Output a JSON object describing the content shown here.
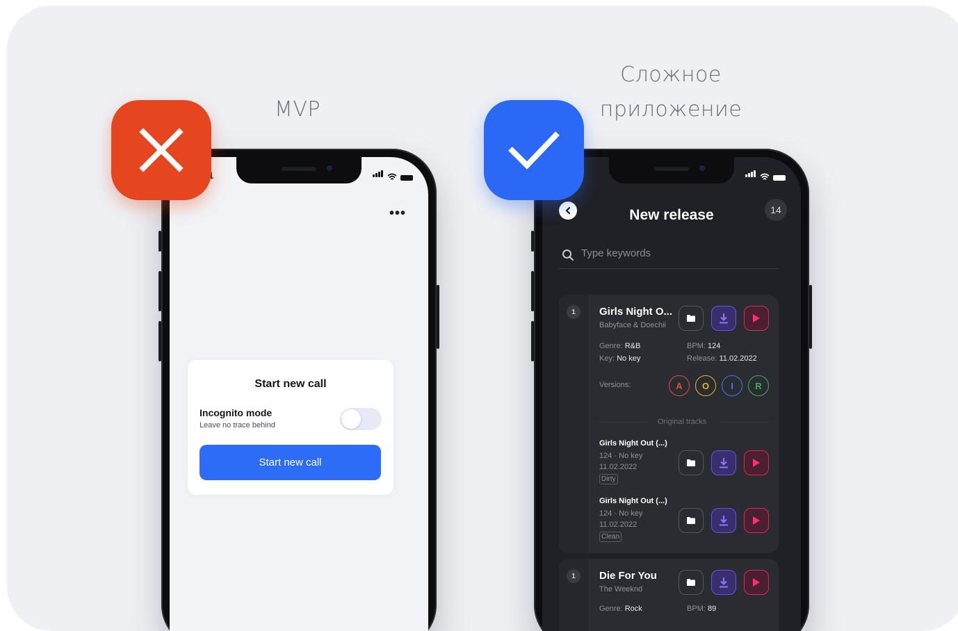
{
  "labels": {
    "mvp": "MVP",
    "complex_line1": "Сложное",
    "complex_line2": "приложение"
  },
  "colors": {
    "bad": "#e5461f",
    "good": "#2a68f5",
    "accent_blue": "#2d6cf6",
    "play_red": "#e0245e",
    "download_purple": "#6b4fe0"
  },
  "mvp_screen": {
    "status_time": "1",
    "menu_icon": "more-dots-icon",
    "dialog": {
      "title": "Start new call",
      "incognito_label": "Incognito mode",
      "incognito_sub": "Leave no trace behind",
      "incognito_on": false,
      "button": "Start new call"
    }
  },
  "complex_screen": {
    "title": "New release",
    "count": "14",
    "search_placeholder": "Type keywords",
    "tracks": [
      {
        "index": "1",
        "title": "Girls Night O...",
        "artist": "Babyface & Doechii",
        "genre_label": "Genre:",
        "genre": "R&B",
        "bpm_label": "BPM:",
        "bpm": "124",
        "key_label": "Key:",
        "key": "No key",
        "release_label": "Release:",
        "release": "11.02.2022",
        "versions_label": "Versions:",
        "versions": [
          "A",
          "O",
          "I",
          "R"
        ],
        "originals_label": "Original tracks",
        "originals": [
          {
            "title": "Girls Night Out (...)",
            "meta": "124 · No key",
            "date": "11.02.2022",
            "tag": "Dirty"
          },
          {
            "title": "Girls Night Out (...)",
            "meta": "124 · No key",
            "date": "11.02.2022",
            "tag": "Clean"
          }
        ]
      },
      {
        "index": "1",
        "title": "Die For You",
        "artist": "The Weeknd",
        "genre_label": "Genre:",
        "genre": "Rock",
        "bpm_label": "BPM:",
        "bpm": "89"
      }
    ]
  }
}
